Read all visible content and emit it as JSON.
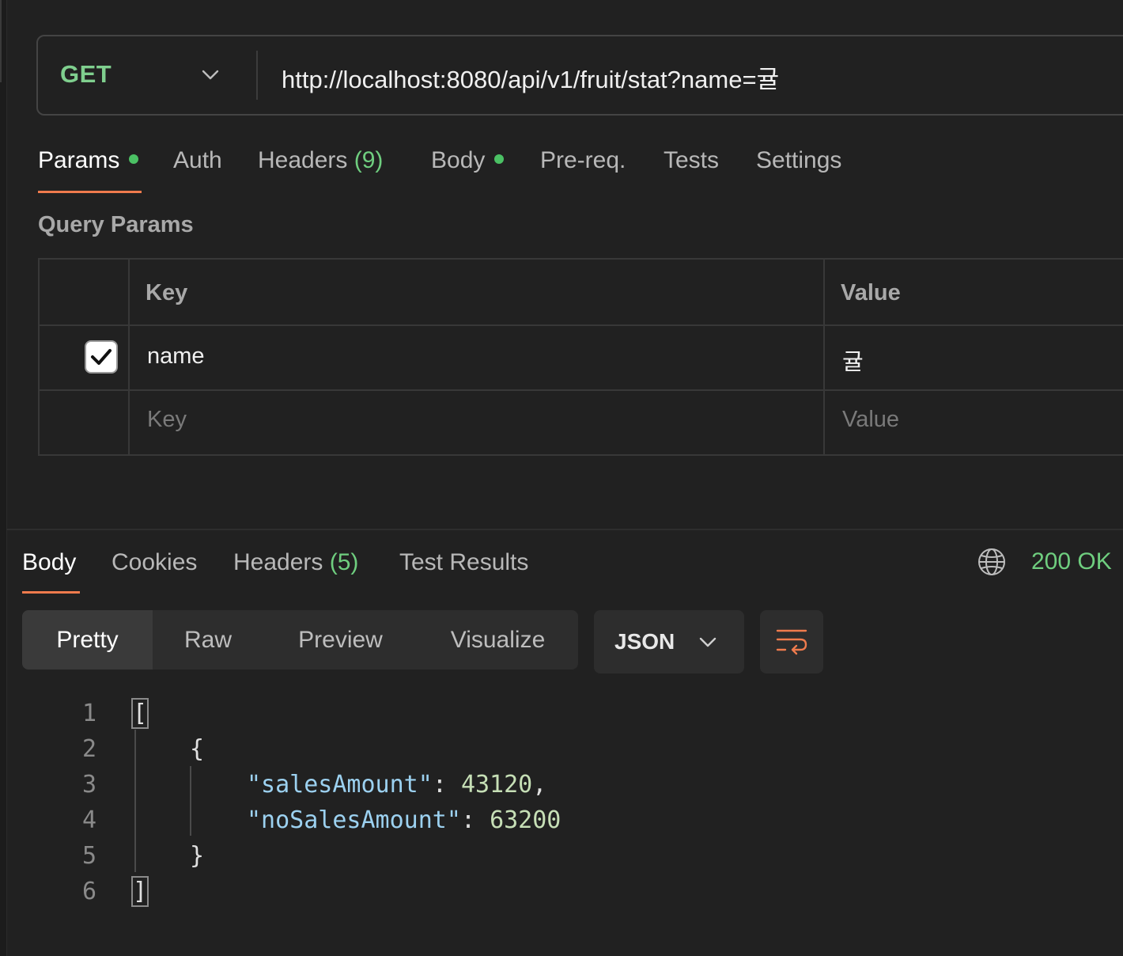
{
  "request": {
    "method": "GET",
    "url": "http://localhost:8080/api/v1/fruit/stat?name=귤"
  },
  "request_tabs": [
    {
      "label": "Params",
      "count": "",
      "dot": true,
      "active": true
    },
    {
      "label": "Auth",
      "count": "",
      "dot": false,
      "active": false
    },
    {
      "label": "Headers",
      "count": "(9)",
      "dot": false,
      "active": false
    },
    {
      "label": "Body",
      "count": "",
      "dot": true,
      "active": false
    },
    {
      "label": "Pre-req.",
      "count": "",
      "dot": false,
      "active": false
    },
    {
      "label": "Tests",
      "count": "",
      "dot": false,
      "active": false
    },
    {
      "label": "Settings",
      "count": "",
      "dot": false,
      "active": false
    }
  ],
  "query_params": {
    "title": "Query Params",
    "headers": {
      "key": "Key",
      "value": "Value"
    },
    "rows": [
      {
        "checked": true,
        "key": "name",
        "value": "귤"
      }
    ],
    "placeholder": {
      "key": "Key",
      "value": "Value"
    }
  },
  "response_tabs": [
    {
      "label": "Body",
      "count": "",
      "active": true
    },
    {
      "label": "Cookies",
      "count": "",
      "active": false
    },
    {
      "label": "Headers",
      "count": "(5)",
      "active": false
    },
    {
      "label": "Test Results",
      "count": "",
      "active": false
    }
  ],
  "status": "200 OK",
  "view_modes": [
    "Pretty",
    "Raw",
    "Preview",
    "Visualize"
  ],
  "active_view_mode": "Pretty",
  "format": "JSON",
  "code": {
    "line_numbers": [
      "1",
      "2",
      "3",
      "4",
      "5",
      "6"
    ],
    "open_bracket": "[",
    "open_brace": "{",
    "entries": [
      {
        "key": "\"salesAmount\"",
        "sep": ": ",
        "value": "43120",
        "trail": ","
      },
      {
        "key": "\"noSalesAmount\"",
        "sep": ": ",
        "value": "63200",
        "trail": ""
      }
    ],
    "close_brace": "}",
    "close_bracket": "]"
  },
  "colors": {
    "accent": "#ef7b4d",
    "method_get": "#7fcf8e",
    "status_ok": "#6fce7f",
    "dot": "#4bc164",
    "background": "#212121"
  },
  "icons": {
    "method_dropdown": "chevron-down-icon",
    "checkbox": "check-icon",
    "network": "globe-icon",
    "format_dropdown": "chevron-down-icon",
    "wrap": "wrap-lines-icon"
  }
}
